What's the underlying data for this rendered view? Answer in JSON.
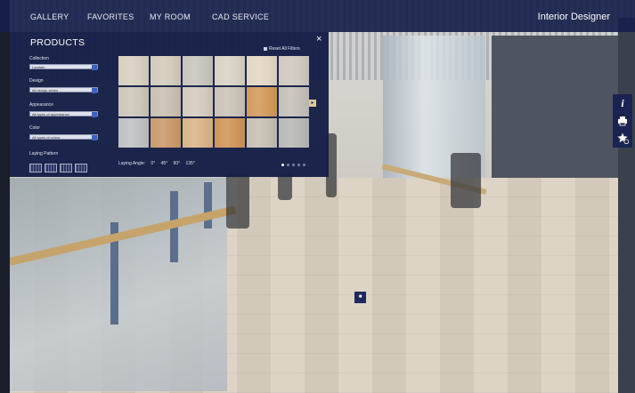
{
  "nav": {
    "items": [
      "GALLERY",
      "FAVORITES",
      "MY ROOM",
      "CAD SERVICE"
    ],
    "brand": "Interior Designer"
  },
  "side": {
    "icons": [
      "info-icon",
      "print-icon",
      "favorite-add-icon"
    ],
    "info_label": "i"
  },
  "panel": {
    "title": "PRODUCTS",
    "close_label": "×",
    "reset_label": "Reset All Filters",
    "filters": [
      {
        "label": "Collection",
        "value": "Laudato"
      },
      {
        "label": "Design",
        "value": "All design series"
      },
      {
        "label": "Appearance",
        "value": "All types of appearance"
      },
      {
        "label": "Color",
        "value": "All types of colors"
      }
    ],
    "laying_patterns_label": "Laying Pattern",
    "laying_angle_label": "Laying Angle:",
    "angles": [
      "0°",
      "45°",
      "90°",
      "135°"
    ],
    "tiles": [
      {
        "color": "#d8cfbf"
      },
      {
        "color": "#d3cbbb"
      },
      {
        "color": "#c8c5bd"
      },
      {
        "color": "#d9d2c4"
      },
      {
        "color": "#e2d7c3"
      },
      {
        "color": "#cfc9bf"
      },
      {
        "color": "#cdc6b9"
      },
      {
        "color": "#c9c0b1"
      },
      {
        "color": "#d4cbbd"
      },
      {
        "color": "#cbc3b6"
      },
      {
        "color": "#d29a5c"
      },
      {
        "color": "#c4c0b9"
      },
      {
        "color": "#bfc1c3"
      },
      {
        "color": "#c99a6c"
      },
      {
        "color": "#d9b48a"
      },
      {
        "color": "#cf9559"
      },
      {
        "color": "#c6bfb3"
      },
      {
        "color": "#b8b8b7"
      }
    ],
    "page_dots": 5,
    "active_dot": 0
  },
  "colors": {
    "nav_bg": "#16204a",
    "panel_bg": "#141e46",
    "accent": "#3b62c4"
  }
}
